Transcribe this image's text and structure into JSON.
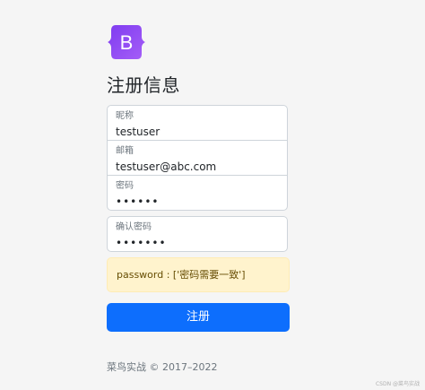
{
  "logo": {
    "letter": "B",
    "gradient": [
      "#7f3cf0",
      "#a55ef7"
    ]
  },
  "title": "注册信息",
  "form": {
    "nickname": {
      "label": "昵称",
      "value": "testuser"
    },
    "email": {
      "label": "邮箱",
      "value": "testuser@abc.com"
    },
    "password": {
      "label": "密码",
      "value": "••••••"
    },
    "confirm_password": {
      "label": "确认密码",
      "value": "•••••••"
    }
  },
  "alert": {
    "text": "password : ['密码需要一致']",
    "color": "#fff3cd"
  },
  "submit": {
    "label": "注册",
    "color": "#0d6efd"
  },
  "footer": "菜鸟实战 © 2017–2022",
  "watermark": "CSDN @菜鸟实战"
}
